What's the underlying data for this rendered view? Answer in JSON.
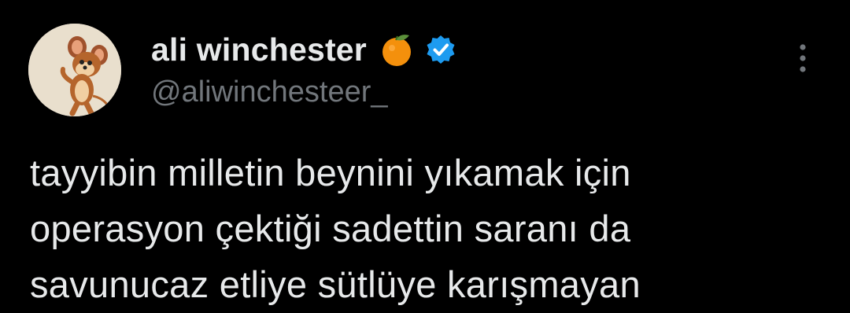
{
  "author": {
    "display_name": "ali winchester",
    "handle": "@aliwinchesteer_",
    "avatar_icon": "jerry-mouse-avatar",
    "badges": [
      "orange-emoji-icon",
      "verified-badge-icon"
    ]
  },
  "tweet": {
    "lines": [
      "tayyibin milletin beynini yıkamak için",
      "operasyon çektiği sadettin saranı da",
      "savunucaz etliye sütlüye karışmayan"
    ]
  },
  "colors": {
    "background": "#000000",
    "text_primary": "#e7e9ea",
    "text_secondary": "#71767b",
    "verified_blue": "#1d9bf0",
    "orange": "#f4900c"
  }
}
